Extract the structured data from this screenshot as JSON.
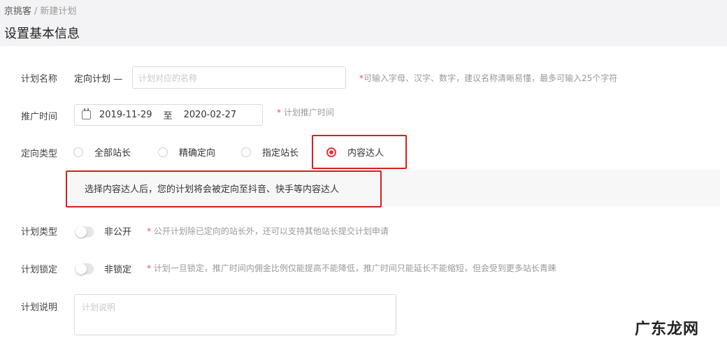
{
  "breadcrumb": {
    "root": "京挑客",
    "separator": "/",
    "current": "新建计划"
  },
  "page_title": "设置基本信息",
  "plan_name": {
    "label": "计划名称",
    "prefix": "定向计划 —",
    "placeholder": "计划对应的名称",
    "hint_star": "*",
    "hint": "可输入字母、汉字、数字，建议名称清晰易懂，最多可输入25个字符"
  },
  "promo_time": {
    "label": "推广时间",
    "start": "2019-11-29",
    "to": "至",
    "end": "2020-02-27",
    "hint_star": "*",
    "hint": "计划推广时间"
  },
  "target_type": {
    "label": "定向类型",
    "options": [
      {
        "label": "全部站长",
        "checked": false
      },
      {
        "label": "精确定向",
        "checked": false
      },
      {
        "label": "指定站长",
        "checked": false
      },
      {
        "label": "内容达人",
        "checked": true
      }
    ],
    "info": "选择内容达人后，您的计划将会被定向至抖音、快手等内容达人"
  },
  "plan_type": {
    "label": "计划类型",
    "toggle_label": "非公开",
    "hint_star": "*",
    "hint": "公开计划除已定向的站长外，还可以支持其他站长提交计划申请"
  },
  "plan_lock": {
    "label": "计划锁定",
    "toggle_label": "非锁定",
    "hint_star": "*",
    "hint": "计划一旦锁定，推广时间内佣金比例仅能提高不能降低，推广时间只能延长不能缩短，但会受到更多站长青睐"
  },
  "plan_desc": {
    "label": "计划说明",
    "placeholder": "计划说明"
  },
  "watermark": "广东龙网",
  "colors": {
    "accent": "#e4393c",
    "highlight_border": "#d81e1e",
    "required_star": "#e0544d"
  }
}
